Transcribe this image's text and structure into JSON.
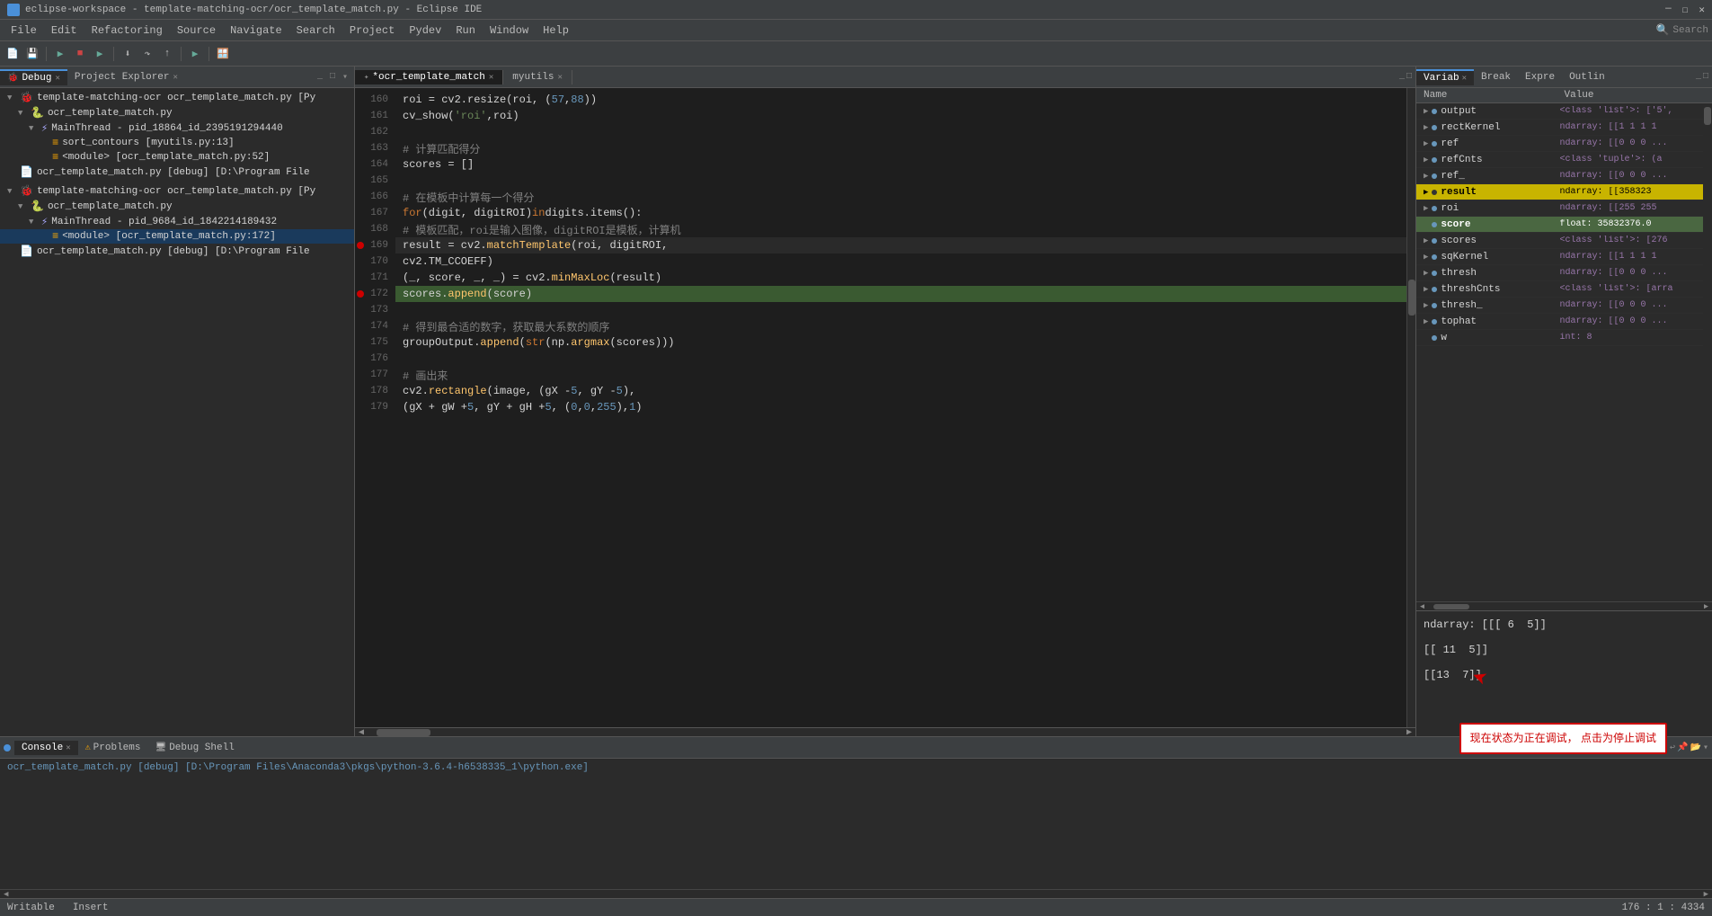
{
  "title": "eclipse-workspace - template-matching-ocr/ocr_template_match.py - Eclipse IDE",
  "menu": {
    "items": [
      "File",
      "Edit",
      "Refactoring",
      "Source",
      "Navigate",
      "Search",
      "Project",
      "Pydev",
      "Run",
      "Window",
      "Help"
    ]
  },
  "leftPanel": {
    "tabs": [
      {
        "label": "Debug",
        "active": true
      },
      {
        "label": "Project Explorer",
        "active": false
      }
    ],
    "tree": [
      {
        "indent": 0,
        "icon": "🐞",
        "label": "template-matching-ocr ocr_template_match.py [Py",
        "hasArrow": true,
        "expanded": true
      },
      {
        "indent": 1,
        "icon": "🐍",
        "label": "ocr_template_match.py",
        "hasArrow": true,
        "expanded": true
      },
      {
        "indent": 2,
        "icon": "⚡",
        "label": "MainThread - pid_18864_id_2395191294440",
        "hasArrow": true,
        "expanded": true
      },
      {
        "indent": 3,
        "icon": "≡",
        "label": "sort_contours [myutils.py:13]",
        "hasArrow": false
      },
      {
        "indent": 3,
        "icon": "≡",
        "label": "<module> [ocr_template_match.py:52]",
        "hasArrow": false
      },
      {
        "indent": 0,
        "icon": "📄",
        "label": "ocr_template_match.py [debug] [D:\\Program File",
        "hasArrow": false
      },
      {
        "indent": 0,
        "icon": "🐞",
        "label": "template-matching-ocr ocr_template_match.py [Py",
        "hasArrow": true,
        "expanded": true
      },
      {
        "indent": 1,
        "icon": "🐍",
        "label": "ocr_template_match.py",
        "hasArrow": true,
        "expanded": true
      },
      {
        "indent": 2,
        "icon": "⚡",
        "label": "MainThread - pid_9684_id_1842214189432",
        "hasArrow": true,
        "expanded": true
      },
      {
        "indent": 3,
        "icon": "≡",
        "label": "<module> [ocr_template_match.py:172]",
        "hasArrow": false,
        "selected": true
      },
      {
        "indent": 0,
        "icon": "📄",
        "label": "ocr_template_match.py [debug] [D:\\Program File",
        "hasArrow": false
      }
    ]
  },
  "editor": {
    "tabs": [
      {
        "label": "*ocr_template_match",
        "active": true,
        "modified": true
      },
      {
        "label": "myutils",
        "active": false
      }
    ],
    "lines": [
      {
        "num": 160,
        "code": "    roi = cv2.resize(roi, (57, 88))"
      },
      {
        "num": 161,
        "code": "    cv_show('roi',roi)"
      },
      {
        "num": 162,
        "code": ""
      },
      {
        "num": 163,
        "code": "    # 计算匹配得分"
      },
      {
        "num": 164,
        "code": "    scores = []"
      },
      {
        "num": 165,
        "code": ""
      },
      {
        "num": 166,
        "code": "    # 在模板中计算每一个得分"
      },
      {
        "num": 167,
        "code": "    for (digit, digitROI) in digits.items():"
      },
      {
        "num": 168,
        "code": "        # 模板匹配，roi是输入图像，digitROI是模板，计算机"
      },
      {
        "num": 169,
        "code": "        result = cv2.matchTemplate(roi, digitROI,",
        "breakpoint": true
      },
      {
        "num": 170,
        "code": "                cv2.TM_CCOEFF)"
      },
      {
        "num": 171,
        "code": "        (_, score, _, _) = cv2.minMaxLoc(result)"
      },
      {
        "num": 172,
        "code": "            scores.append(score)",
        "current": true,
        "breakpoint": true
      },
      {
        "num": 173,
        "code": ""
      },
      {
        "num": 174,
        "code": "        # 得到最合适的数字，获取最大系数的顺序"
      },
      {
        "num": 175,
        "code": "        groupOutput.append(str(np.argmax(scores)))"
      },
      {
        "num": 176,
        "code": ""
      },
      {
        "num": 177,
        "code": "    # 画出来"
      },
      {
        "num": 178,
        "code": "    cv2.rectangle(image, (gX - 5, gY - 5),"
      },
      {
        "num": 179,
        "code": "        (gX + gW + 5, gY + gH + 5), (0, 0, 255), 1)"
      }
    ]
  },
  "rightPanel": {
    "tabs": [
      "Variab",
      "Break",
      "Expre",
      "Outlin"
    ],
    "activeTab": "Variab",
    "header": {
      "name": "Name",
      "value": "Value"
    },
    "variables": [
      {
        "name": "output",
        "value": "<class 'list'>: ['5',",
        "arrow": true
      },
      {
        "name": "rectKernel",
        "value": "ndarray: [[1 1 1 1",
        "arrow": true
      },
      {
        "name": "ref",
        "value": "ndarray: [[0 0 0 ...",
        "arrow": true
      },
      {
        "name": "refCnts",
        "value": "<class 'tuple'>: (a",
        "arrow": true
      },
      {
        "name": "ref_",
        "value": "ndarray: [[0 0 0 ...",
        "arrow": true
      },
      {
        "name": "result",
        "value": "ndarray: [[358323",
        "arrow": true,
        "highlighted": true
      },
      {
        "name": "roi",
        "value": "ndarray: [[255 255",
        "arrow": true
      },
      {
        "name": "score",
        "value": "float: 35832376.0",
        "arrow": false,
        "highlighted2": true
      },
      {
        "name": "scores",
        "value": "<class 'list'>: [276",
        "arrow": true
      },
      {
        "name": "sqKernel",
        "value": "ndarray: [[1 1 1 1",
        "arrow": true
      },
      {
        "name": "thresh",
        "value": "ndarray: [[0 0 0 ...",
        "arrow": true
      },
      {
        "name": "threshCnts",
        "value": "<class 'list'>: [arra",
        "arrow": true
      },
      {
        "name": "thresh_",
        "value": "ndarray: [[0 0 0 ...",
        "arrow": true
      },
      {
        "name": "tophat",
        "value": "ndarray: [[0 0 0 ...",
        "arrow": true
      },
      {
        "name": "w",
        "value": "int: 8",
        "arrow": false
      }
    ],
    "preview": "ndarray: [[[ 6  5]]\n\n[[ 11  5]]\n\n[[13  7]]"
  },
  "bottomPanel": {
    "tabs": [
      "Console",
      "Problems",
      "Debug Shell"
    ],
    "activeTab": "Console",
    "consolePath": "ocr_template_match.py [debug] [D:\\Program Files\\Anaconda3\\pkgs\\python-3.6.4-h6538335_1\\python.exe]"
  },
  "statusBar": {
    "mode": "Writable",
    "insert": "Insert",
    "position": "176 : 1 : 4334"
  },
  "annotation": {
    "text": "现在状态为正在调试，\n点击为停止调试",
    "visible": true
  }
}
